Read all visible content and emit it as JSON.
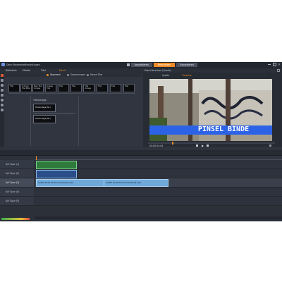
{
  "app": {
    "menu": [
      "Datei",
      "Bearbeiten",
      "Einstellungen"
    ],
    "tabs": [
      {
        "label": "Importieren",
        "active": false
      },
      {
        "label": "Bearbeiten",
        "active": true
      },
      {
        "label": "Exportieren",
        "active": false
      }
    ],
    "accent": "#f08a24"
  },
  "library": {
    "tabs": [
      "Bibliothek",
      "Effekte",
      "Titel",
      "Menü"
    ],
    "subtabs": [
      "Standard",
      "Sammlungen",
      "Meine Titel"
    ],
    "thumbnails": [
      "Titel",
      "Schöner Titel Bitte",
      "Mein Titel Vorlage",
      "Vorlage Titel",
      "Titel",
      "Titel",
      "Titel Vorlage",
      "Titel",
      "Titel",
      "Titel"
    ],
    "section_label": "Titelvorlage",
    "cards": [
      "Titelvorlage (Nr.)",
      "Titelvorlage (Nr.)"
    ]
  },
  "preview": {
    "header": "Datei-Vorschau (Quelle)",
    "tabs": [
      "Quelle",
      "Timeline"
    ],
    "overlay_text": "PINSEL BINDE",
    "timecode": "00:00:04:04"
  },
  "timeline": {
    "tracks": [
      "A/V Spur (1)",
      "A/V Spur (2)",
      "A/V Spur (3)",
      "A/V Spur (4)",
      "A/V Spur (5)"
    ],
    "clip_label": "Graffiti Pinsel Binde Schwarzweiß.mp4",
    "clip_label_2": "Graffiti Pinsel Binde Schwarzweiß.mp4"
  }
}
